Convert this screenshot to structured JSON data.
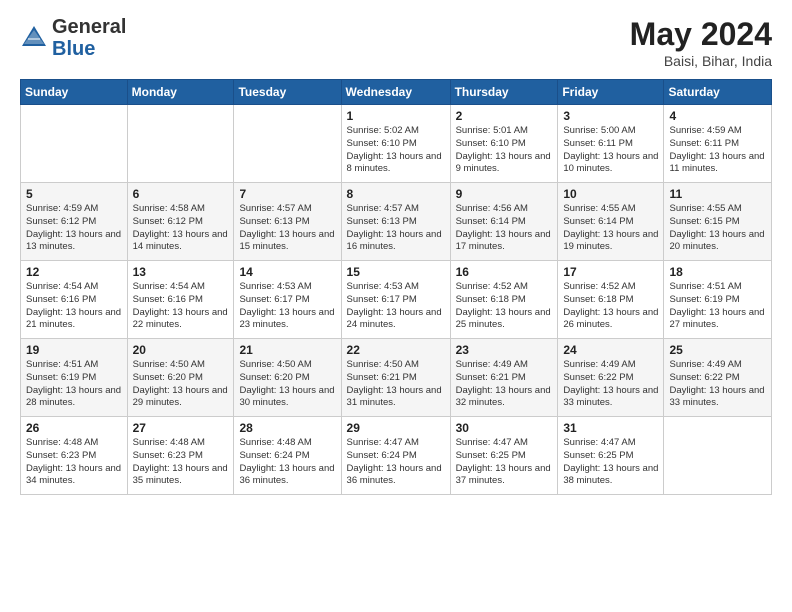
{
  "header": {
    "logo_general": "General",
    "logo_blue": "Blue",
    "title": "May 2024",
    "location": "Baisi, Bihar, India"
  },
  "weekdays": [
    "Sunday",
    "Monday",
    "Tuesday",
    "Wednesday",
    "Thursday",
    "Friday",
    "Saturday"
  ],
  "weeks": [
    [
      {
        "day": "",
        "info": ""
      },
      {
        "day": "",
        "info": ""
      },
      {
        "day": "",
        "info": ""
      },
      {
        "day": "1",
        "info": "Sunrise: 5:02 AM\nSunset: 6:10 PM\nDaylight: 13 hours and 8 minutes."
      },
      {
        "day": "2",
        "info": "Sunrise: 5:01 AM\nSunset: 6:10 PM\nDaylight: 13 hours and 9 minutes."
      },
      {
        "day": "3",
        "info": "Sunrise: 5:00 AM\nSunset: 6:11 PM\nDaylight: 13 hours and 10 minutes."
      },
      {
        "day": "4",
        "info": "Sunrise: 4:59 AM\nSunset: 6:11 PM\nDaylight: 13 hours and 11 minutes."
      }
    ],
    [
      {
        "day": "5",
        "info": "Sunrise: 4:59 AM\nSunset: 6:12 PM\nDaylight: 13 hours and 13 minutes."
      },
      {
        "day": "6",
        "info": "Sunrise: 4:58 AM\nSunset: 6:12 PM\nDaylight: 13 hours and 14 minutes."
      },
      {
        "day": "7",
        "info": "Sunrise: 4:57 AM\nSunset: 6:13 PM\nDaylight: 13 hours and 15 minutes."
      },
      {
        "day": "8",
        "info": "Sunrise: 4:57 AM\nSunset: 6:13 PM\nDaylight: 13 hours and 16 minutes."
      },
      {
        "day": "9",
        "info": "Sunrise: 4:56 AM\nSunset: 6:14 PM\nDaylight: 13 hours and 17 minutes."
      },
      {
        "day": "10",
        "info": "Sunrise: 4:55 AM\nSunset: 6:14 PM\nDaylight: 13 hours and 19 minutes."
      },
      {
        "day": "11",
        "info": "Sunrise: 4:55 AM\nSunset: 6:15 PM\nDaylight: 13 hours and 20 minutes."
      }
    ],
    [
      {
        "day": "12",
        "info": "Sunrise: 4:54 AM\nSunset: 6:16 PM\nDaylight: 13 hours and 21 minutes."
      },
      {
        "day": "13",
        "info": "Sunrise: 4:54 AM\nSunset: 6:16 PM\nDaylight: 13 hours and 22 minutes."
      },
      {
        "day": "14",
        "info": "Sunrise: 4:53 AM\nSunset: 6:17 PM\nDaylight: 13 hours and 23 minutes."
      },
      {
        "day": "15",
        "info": "Sunrise: 4:53 AM\nSunset: 6:17 PM\nDaylight: 13 hours and 24 minutes."
      },
      {
        "day": "16",
        "info": "Sunrise: 4:52 AM\nSunset: 6:18 PM\nDaylight: 13 hours and 25 minutes."
      },
      {
        "day": "17",
        "info": "Sunrise: 4:52 AM\nSunset: 6:18 PM\nDaylight: 13 hours and 26 minutes."
      },
      {
        "day": "18",
        "info": "Sunrise: 4:51 AM\nSunset: 6:19 PM\nDaylight: 13 hours and 27 minutes."
      }
    ],
    [
      {
        "day": "19",
        "info": "Sunrise: 4:51 AM\nSunset: 6:19 PM\nDaylight: 13 hours and 28 minutes."
      },
      {
        "day": "20",
        "info": "Sunrise: 4:50 AM\nSunset: 6:20 PM\nDaylight: 13 hours and 29 minutes."
      },
      {
        "day": "21",
        "info": "Sunrise: 4:50 AM\nSunset: 6:20 PM\nDaylight: 13 hours and 30 minutes."
      },
      {
        "day": "22",
        "info": "Sunrise: 4:50 AM\nSunset: 6:21 PM\nDaylight: 13 hours and 31 minutes."
      },
      {
        "day": "23",
        "info": "Sunrise: 4:49 AM\nSunset: 6:21 PM\nDaylight: 13 hours and 32 minutes."
      },
      {
        "day": "24",
        "info": "Sunrise: 4:49 AM\nSunset: 6:22 PM\nDaylight: 13 hours and 33 minutes."
      },
      {
        "day": "25",
        "info": "Sunrise: 4:49 AM\nSunset: 6:22 PM\nDaylight: 13 hours and 33 minutes."
      }
    ],
    [
      {
        "day": "26",
        "info": "Sunrise: 4:48 AM\nSunset: 6:23 PM\nDaylight: 13 hours and 34 minutes."
      },
      {
        "day": "27",
        "info": "Sunrise: 4:48 AM\nSunset: 6:23 PM\nDaylight: 13 hours and 35 minutes."
      },
      {
        "day": "28",
        "info": "Sunrise: 4:48 AM\nSunset: 6:24 PM\nDaylight: 13 hours and 36 minutes."
      },
      {
        "day": "29",
        "info": "Sunrise: 4:47 AM\nSunset: 6:24 PM\nDaylight: 13 hours and 36 minutes."
      },
      {
        "day": "30",
        "info": "Sunrise: 4:47 AM\nSunset: 6:25 PM\nDaylight: 13 hours and 37 minutes."
      },
      {
        "day": "31",
        "info": "Sunrise: 4:47 AM\nSunset: 6:25 PM\nDaylight: 13 hours and 38 minutes."
      },
      {
        "day": "",
        "info": ""
      }
    ]
  ]
}
